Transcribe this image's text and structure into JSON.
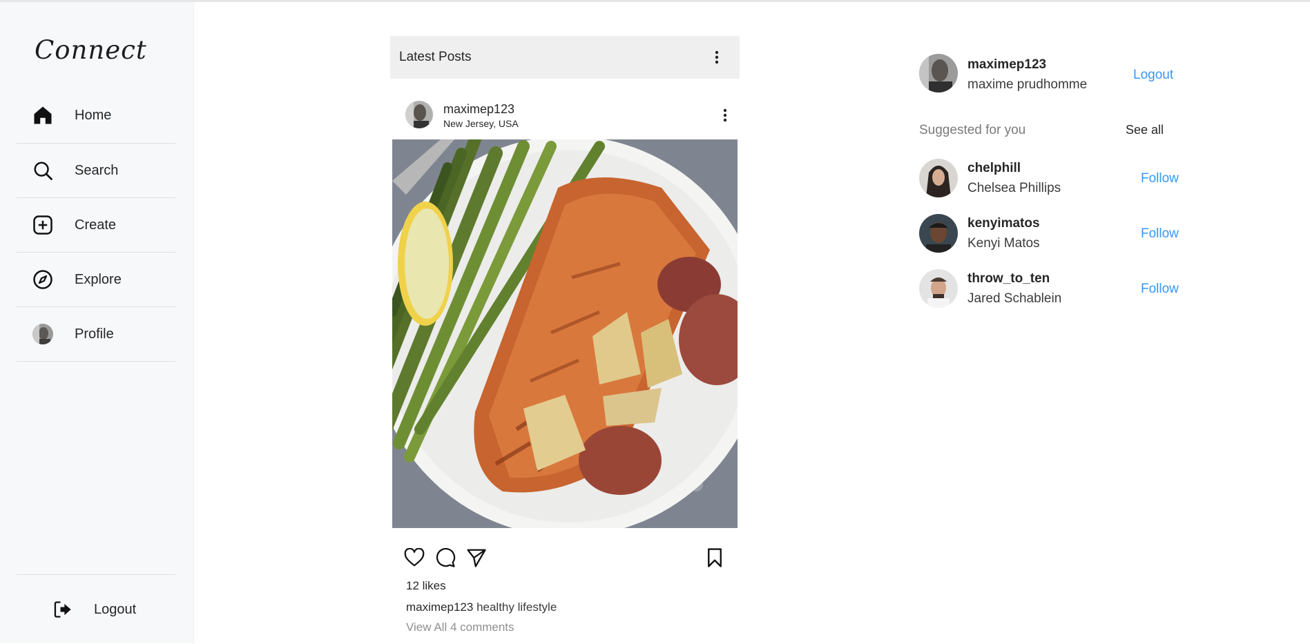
{
  "app": {
    "brand": "Connect"
  },
  "sidebar": {
    "items": [
      {
        "label": "Home",
        "icon": "home-icon"
      },
      {
        "label": "Search",
        "icon": "search-icon"
      },
      {
        "label": "Create",
        "icon": "plus-square-icon"
      },
      {
        "label": "Explore",
        "icon": "compass-icon"
      },
      {
        "label": "Profile",
        "icon": "avatar"
      }
    ],
    "logout_label": "Logout"
  },
  "feed": {
    "header_title": "Latest Posts",
    "post": {
      "username": "maximep123",
      "location": "New Jersey, USA",
      "likes": "12 likes",
      "caption_user": "maximep123",
      "caption_text": "healthy lifestyle",
      "view_comments": "View All 4 comments",
      "image_icon": "salmon-plate-image"
    }
  },
  "right": {
    "me": {
      "username": "maximep123",
      "full_name": "maxime prudhomme",
      "logout_label": "Logout"
    },
    "suggestions_title": "Suggested for you",
    "see_all_label": "See all",
    "suggestions": [
      {
        "username": "chelphill",
        "full_name": "Chelsea Phillips",
        "follow_label": "Follow"
      },
      {
        "username": "kenyimatos",
        "full_name": "Kenyi Matos",
        "follow_label": "Follow"
      },
      {
        "username": "throw_to_ten",
        "full_name": "Jared Schablein",
        "follow_label": "Follow"
      }
    ]
  },
  "colors": {
    "accent": "#3897f0",
    "sidebar_bg": "#f7f8fa",
    "header_bg": "#efefef"
  }
}
